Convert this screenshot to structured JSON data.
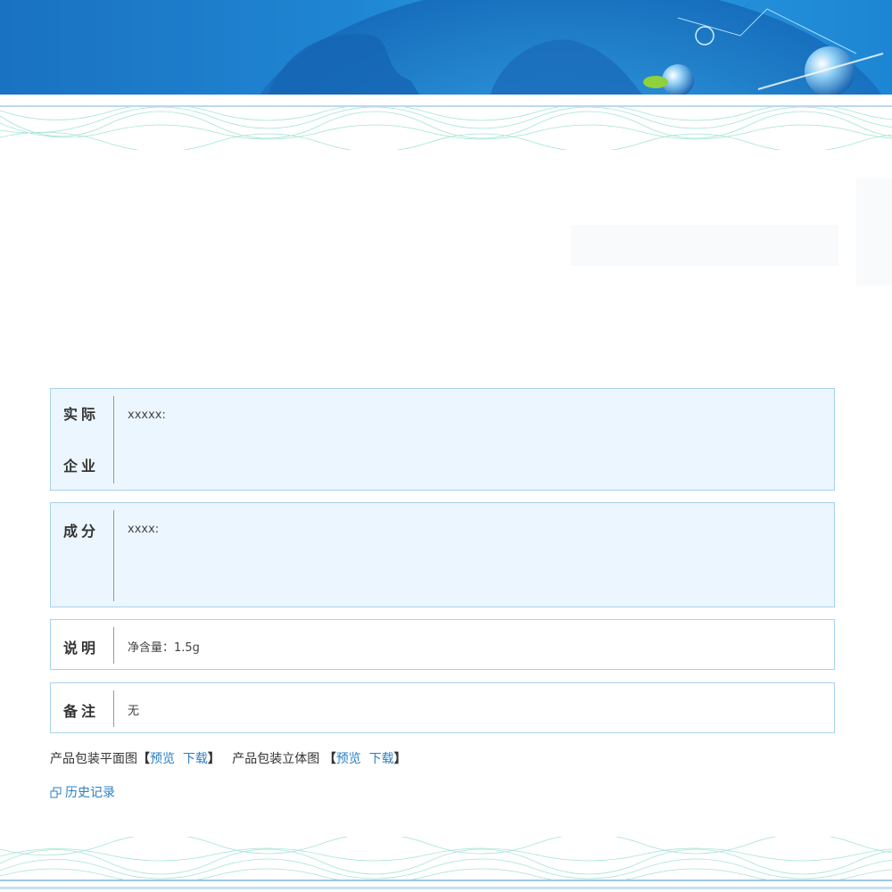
{
  "colors": {
    "banner_blue": "#1f86d3",
    "row_border": "#a9d2ef",
    "row_blue_bg": "#ecf6fe",
    "link_blue": "#2b7fc4"
  },
  "rows": [
    {
      "label_line1": "实际",
      "label_line2": "企业",
      "value": "xxxxx:"
    },
    {
      "label": "成分",
      "value": "xxxx:"
    },
    {
      "label": "说明",
      "value": "净含量：1.5g"
    },
    {
      "label": "备注",
      "value": "无"
    }
  ],
  "links": {
    "flat_label": "产品包装平面图",
    "flat_open": "【",
    "flat_preview": "预览",
    "flat_download": "下载",
    "flat_close": "】",
    "solid_label": "产品包装立体图",
    "solid_open": "【",
    "solid_preview": "预览",
    "solid_download": "下载",
    "solid_close": "】"
  },
  "history": {
    "label": "历史记录",
    "icon": "window-icon"
  }
}
